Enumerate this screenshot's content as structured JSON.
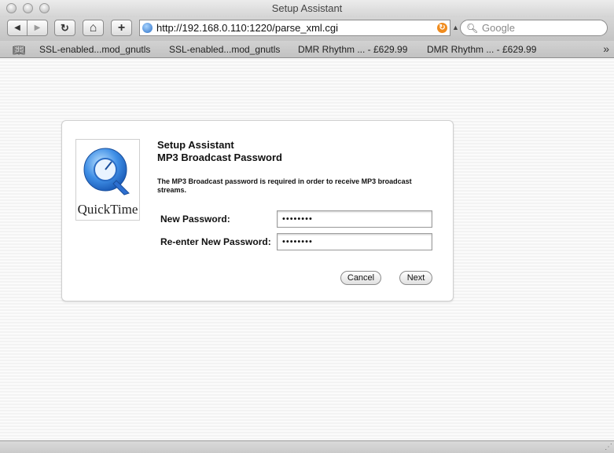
{
  "window": {
    "title": "Setup Assistant"
  },
  "toolbar": {
    "back_glyph": "◀",
    "forward_glyph": "▶",
    "reload_glyph": "↻",
    "home_glyph": "⌂",
    "add_glyph": "+",
    "url": "http://192.168.0.110:1220/parse_xml.cgi",
    "search_placeholder": "Google"
  },
  "bookmarks": {
    "items": [
      {
        "label": "SSL-enabled...mod_gnutls"
      },
      {
        "label": "SSL-enabled...mod_gnutls"
      },
      {
        "label": "DMR Rhythm ... - £629.99"
      },
      {
        "label": "DMR Rhythm ... - £629.99"
      }
    ]
  },
  "dialog": {
    "logo_text": "QuickTime",
    "title": "Setup Assistant",
    "subtitle": "MP3 Broadcast Password",
    "description": "The MP3 Broadcast password is required in order to receive MP3 broadcast streams.",
    "new_password_label": "New Password:",
    "new_password_value": "••••••••",
    "reenter_password_label": "Re-enter New Password:",
    "reenter_password_value": "••••••••",
    "cancel_label": "Cancel",
    "next_label": "Next"
  },
  "colors": {
    "quicktime_blue": "#2b78d8",
    "reload_orange": "#f08c1e"
  }
}
